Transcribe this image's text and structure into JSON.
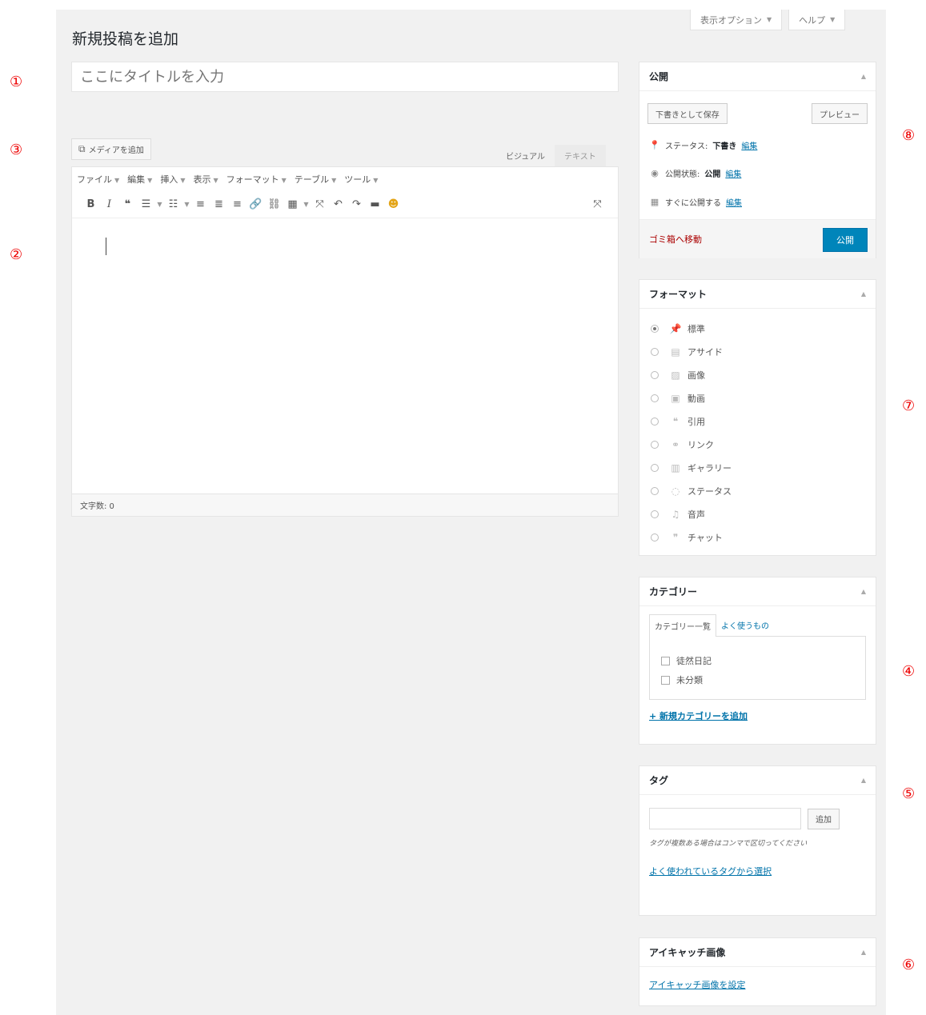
{
  "screen_options": {
    "display_options": "表示オプション",
    "help": "ヘルプ"
  },
  "page_title": "新規投稿を追加",
  "title_placeholder": "ここにタイトルを入力",
  "media_button": "メディアを追加",
  "editor_tabs": {
    "visual": "ビジュアル",
    "text": "テキスト"
  },
  "menubar": [
    "ファイル",
    "編集",
    "挿入",
    "表示",
    "フォーマット",
    "テーブル",
    "ツール"
  ],
  "toolbar_icons": [
    "bold-icon",
    "italic-icon",
    "blockquote-icon",
    "bullet-list-icon",
    "numbered-list-icon",
    "align-left-icon",
    "align-center-icon",
    "align-right-icon",
    "link-icon",
    "unlink-icon",
    "table-icon",
    "fullscreen-icon",
    "undo-icon",
    "redo-icon",
    "readmore-icon",
    "emoji-icon",
    "expand-icon"
  ],
  "word_count": "文字数: 0",
  "publish": {
    "title": "公開",
    "save_draft": "下書きとして保存",
    "preview": "プレビュー",
    "status_label": "ステータス: ",
    "status_value": "下書き",
    "visibility_label": "公開状態: ",
    "visibility_value": "公開",
    "schedule_label": "すぐに公開する",
    "edit": "編集",
    "trash": "ゴミ箱へ移動",
    "publish_button": "公開"
  },
  "format": {
    "title": "フォーマット",
    "items": [
      {
        "label": "標準",
        "icon": "pin-icon",
        "selected": true
      },
      {
        "label": "アサイド",
        "icon": "aside-icon",
        "selected": false
      },
      {
        "label": "画像",
        "icon": "image-icon",
        "selected": false
      },
      {
        "label": "動画",
        "icon": "video-icon",
        "selected": false
      },
      {
        "label": "引用",
        "icon": "quote-icon",
        "selected": false
      },
      {
        "label": "リンク",
        "icon": "link-icon",
        "selected": false
      },
      {
        "label": "ギャラリー",
        "icon": "gallery-icon",
        "selected": false
      },
      {
        "label": "ステータス",
        "icon": "chat-bubble-icon",
        "selected": false
      },
      {
        "label": "音声",
        "icon": "music-icon",
        "selected": false
      },
      {
        "label": "チャット",
        "icon": "chat-icon",
        "selected": false
      }
    ]
  },
  "category": {
    "title": "カテゴリー",
    "tab_all": "カテゴリー一覧",
    "tab_popular": "よく使うもの",
    "items": [
      "徒然日記",
      "未分類"
    ],
    "add_new": "+ 新規カテゴリーを追加"
  },
  "tags": {
    "title": "タグ",
    "add_button": "追加",
    "hint": "タグが複数ある場合はコンマで区切ってください",
    "choose_popular": "よく使われているタグから選択"
  },
  "featured_image": {
    "title": "アイキャッチ画像",
    "set_link": "アイキャッチ画像を設定"
  },
  "annotations": [
    "①",
    "②",
    "③",
    "④",
    "⑤",
    "⑥",
    "⑦",
    "⑧"
  ]
}
